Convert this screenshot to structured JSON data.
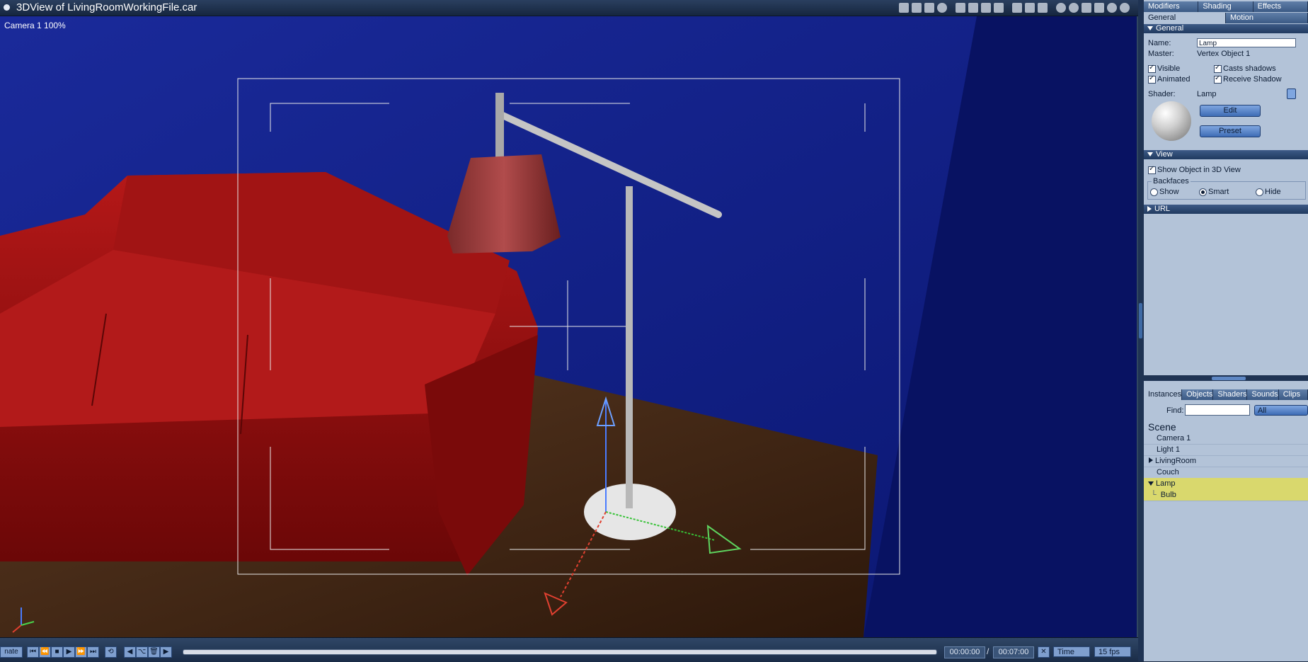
{
  "window": {
    "title": "3DView of LivingRoomWorkingFile.car"
  },
  "viewport": {
    "camera_label": "Camera 1 100%"
  },
  "timeline": {
    "left_button_label": "nate",
    "current_time": "00:00:00",
    "separator": "/",
    "end_time": "00:07:00",
    "mode_label": "Time",
    "fps_label": "15 fps"
  },
  "panel": {
    "top_tabs": [
      "Modifiers",
      "Shading",
      "Effects"
    ],
    "sub_tabs": [
      "General",
      "Motion"
    ],
    "general": {
      "header": "General",
      "name_label": "Name:",
      "name_value": "Lamp",
      "master_label": "Master:",
      "master_value": "Vertex Object 1",
      "visible": "Visible",
      "casts_shadows": "Casts shadows",
      "animated": "Animated",
      "receive_shadow": "Receive Shadow",
      "shader_label": "Shader:",
      "shader_value": "Lamp",
      "edit_button": "Edit",
      "preset_button": "Preset"
    },
    "view": {
      "header": "View",
      "show_object": "Show Object in 3D View",
      "backfaces_label": "Backfaces",
      "backfaces_options": [
        "Show",
        "Smart",
        "Hide"
      ],
      "selected": "Smart"
    },
    "url": {
      "header": "URL"
    },
    "browser": {
      "tabs": [
        "Instances",
        "Objects",
        "Shaders",
        "Sounds",
        "Clips"
      ],
      "find_label": "Find:",
      "find_value": "",
      "filter_value": "All",
      "tree_title": "Scene",
      "items": [
        {
          "label": "Camera 1",
          "indent": 0,
          "expander": "",
          "selected": false
        },
        {
          "label": "Light 1",
          "indent": 0,
          "expander": "",
          "selected": false
        },
        {
          "label": "LivingRoom",
          "indent": 0,
          "expander": "collapsed",
          "selected": false
        },
        {
          "label": "Couch",
          "indent": 0,
          "expander": "",
          "selected": false
        },
        {
          "label": "Lamp",
          "indent": 0,
          "expander": "expanded",
          "selected": true
        },
        {
          "label": "Bulb",
          "indent": 1,
          "expander": "",
          "selected": true
        }
      ]
    }
  },
  "colors": {
    "background_wall": "#0d1c8c",
    "couch": "#9c1212",
    "floor": "#4a2a14",
    "selection": "#d9d86d",
    "panel": "#b3c3d8"
  }
}
